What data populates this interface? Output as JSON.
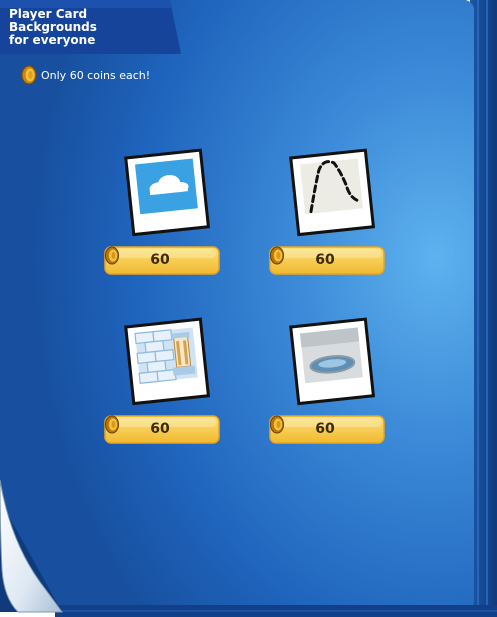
{
  "header": {
    "title": "Player Card Backgrounds\nfor everyone"
  },
  "promo": {
    "text": "Only 60 coins each!",
    "icon": "coin-icon"
  },
  "items": [
    {
      "name": "sky-cloud-background",
      "price": "60",
      "icon": "coin-icon"
    },
    {
      "name": "dotted-path-background",
      "price": "60",
      "icon": "coin-icon"
    },
    {
      "name": "igloo-wall-background",
      "price": "60",
      "icon": "coin-icon"
    },
    {
      "name": "pool-room-background",
      "price": "60",
      "icon": "coin-icon"
    }
  ],
  "colors": {
    "page_blue": "#1d62b8",
    "page_highlight": "#4fa3e6",
    "header_tab": "#16449a",
    "button_gold": "#f5c842",
    "coin_gold": "#e0a021"
  }
}
